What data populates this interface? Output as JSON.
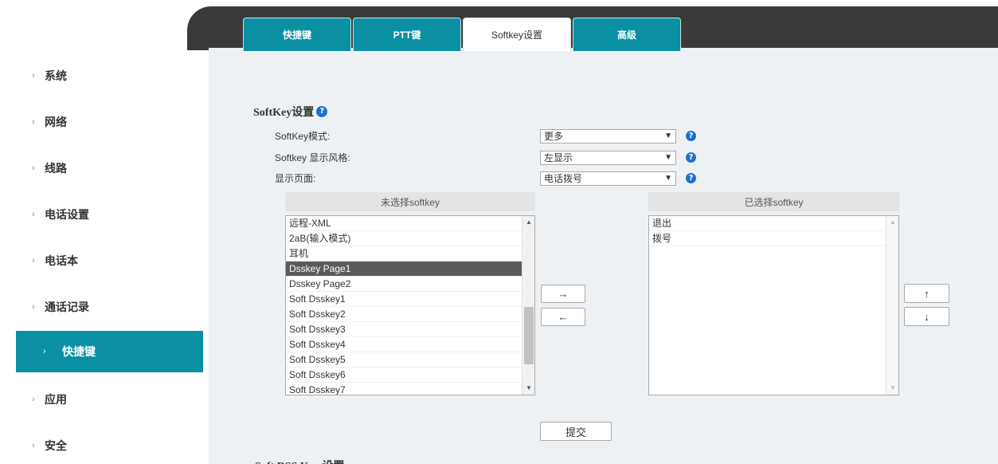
{
  "sidebar": {
    "items": [
      {
        "label": "系统",
        "active": false
      },
      {
        "label": "网络",
        "active": false
      },
      {
        "label": "线路",
        "active": false
      },
      {
        "label": "电话设置",
        "active": false
      },
      {
        "label": "电话本",
        "active": false
      },
      {
        "label": "通话记录",
        "active": false
      },
      {
        "label": "快捷键",
        "active": true
      },
      {
        "label": "应用",
        "active": false
      },
      {
        "label": "安全",
        "active": false
      }
    ]
  },
  "tabs": [
    {
      "label": "快捷键",
      "active": false
    },
    {
      "label": "PTT键",
      "active": false
    },
    {
      "label": "Softkey设置",
      "active": true
    },
    {
      "label": "高级",
      "active": false
    }
  ],
  "section": {
    "title": "SoftKey设置",
    "fields": [
      {
        "label": "SoftKey模式:",
        "value": "更多"
      },
      {
        "label": "Softkey 显示风格:",
        "value": "左显示"
      },
      {
        "label": "显示页面:",
        "value": "电话拨号"
      }
    ]
  },
  "unselected": {
    "header": "未选择softkey",
    "items": [
      "远程-XML",
      "2aB(输入模式)",
      "耳机",
      "Dsskey Page1",
      "Dsskey Page2",
      "Soft Dsskey1",
      "Soft Dsskey2",
      "Soft Dsskey3",
      "Soft Dsskey4",
      "Soft Dsskey5",
      "Soft Dsskey6",
      "Soft Dsskey7"
    ],
    "selected_item": "Dsskey Page1"
  },
  "selected": {
    "header": "已选择softkey",
    "items": [
      "退出",
      "拨号"
    ]
  },
  "buttons": {
    "move_right": "→",
    "move_left": "←",
    "move_up": "↑",
    "move_down": "↓",
    "submit": "提交"
  },
  "next_section_title": "Soft DSS Key 设置",
  "icons": {
    "help": "help-icon",
    "chevron": "chevron-right-icon",
    "dropdown": "chevron-down-icon"
  },
  "colors": {
    "accent": "#0a8fa3",
    "dark_band": "#3a3a3a",
    "help_blue": "#1e6fd0"
  }
}
